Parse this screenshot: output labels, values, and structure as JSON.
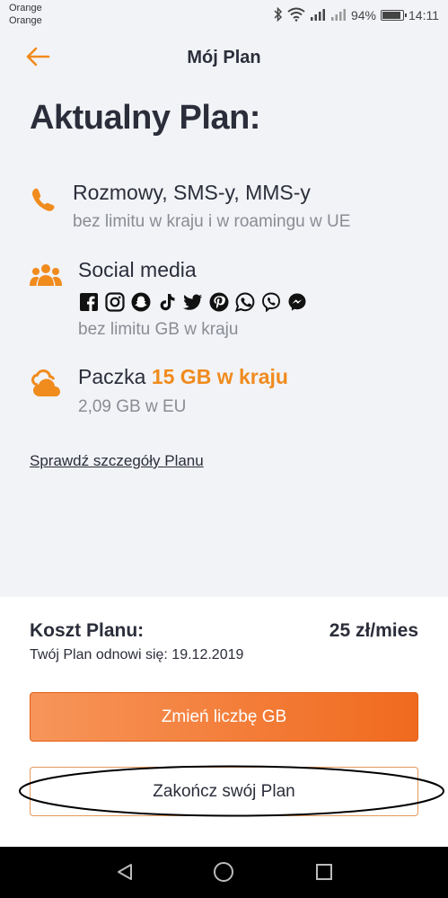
{
  "status_bar": {
    "carrier_line1": "Orange",
    "carrier_line2": "Orange",
    "battery_percent": "94%",
    "battery_level": 0.94,
    "time": "14:11"
  },
  "header": {
    "title": "Mój Plan"
  },
  "plan": {
    "heading": "Aktualny Plan:",
    "calls": {
      "title": "Rozmowy, SMS-y, MMS-y",
      "subtitle": "bez limitu w kraju i w roamingu w UE"
    },
    "social": {
      "title": "Social media",
      "apps": [
        "facebook-icon",
        "instagram-icon",
        "snapchat-icon",
        "tiktok-icon",
        "twitter-icon",
        "pinterest-icon",
        "whatsapp-icon",
        "viber-icon",
        "messenger-icon"
      ],
      "subtitle": "bez limitu GB w kraju"
    },
    "data": {
      "title_prefix": "Paczka ",
      "title_accent": "15 GB w kraju",
      "subtitle": "2,09 GB w EU"
    },
    "details_link": "Sprawdź szczegóły Planu"
  },
  "cost": {
    "label": "Koszt Planu:",
    "value": "25 zł/mies",
    "renewal": "Twój Plan odnowi się: 19.12.2019"
  },
  "actions": {
    "change_gb": "Zmień liczbę GB",
    "end_plan": "Zakończ swój Plan"
  },
  "colors": {
    "accent": "#f08b1d",
    "button_gradient_start": "#f7955a",
    "button_gradient_end": "#f06a1e",
    "text": "#2b2e3a",
    "muted": "#8a8c94",
    "background": "#f2f3f7"
  }
}
